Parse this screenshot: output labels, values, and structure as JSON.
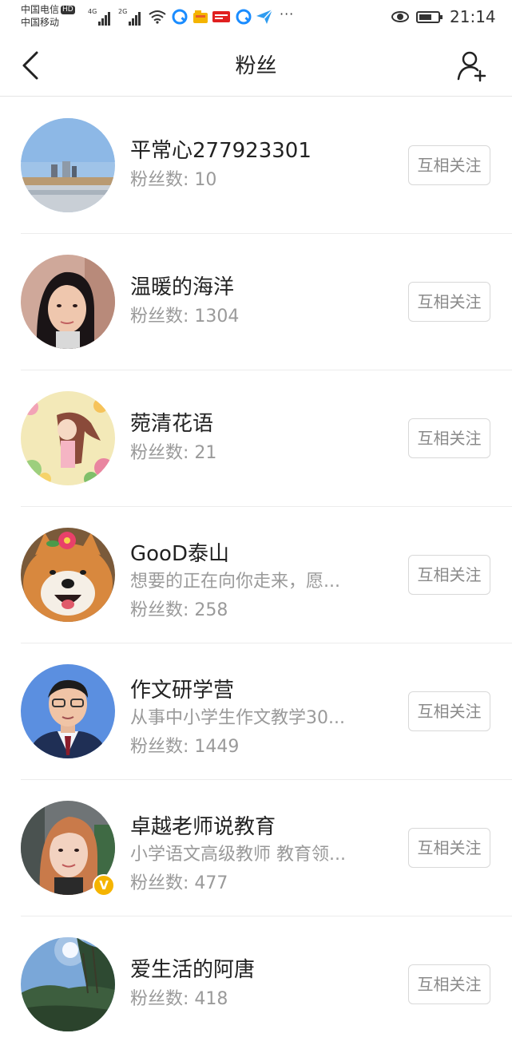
{
  "status_bar": {
    "carrier_1": "中国电信",
    "hd_badge": "HD",
    "carrier_2": "中国移动",
    "net_1": "4G",
    "net_2": "2G",
    "time": "21:14",
    "more": "···"
  },
  "nav": {
    "title": "粉丝",
    "back_icon": "back-chevron-icon",
    "add_icon": "add-user-icon"
  },
  "follow_label": "互相关注",
  "fans": [
    {
      "name": "平常心277923301",
      "desc": "",
      "fans": "粉丝数: 10",
      "avatar": "lakeside-landscape"
    },
    {
      "name": "温暖的海洋",
      "desc": "",
      "fans": "粉丝数: 1304",
      "avatar": "woman-portrait"
    },
    {
      "name": "菀清花语",
      "desc": "",
      "fans": "粉丝数: 21",
      "avatar": "floral-anime-girl"
    },
    {
      "name": "GooD泰山",
      "desc": "想要的正在向你走来，愿...",
      "fans": "粉丝数: 258",
      "avatar": "shiba-dog-with-flower"
    },
    {
      "name": "作文研学营",
      "desc": "从事中小学生作文教学30...",
      "fans": "粉丝数: 1449",
      "avatar": "man-in-suit"
    },
    {
      "name": "卓越老师说教育",
      "desc": "小学语文高级教师 教育领...",
      "fans": "粉丝数: 477",
      "avatar": "woman-selfie",
      "verified": "V"
    },
    {
      "name": "爱生活的阿唐",
      "desc": "",
      "fans": "粉丝数: 418",
      "avatar": "sky-and-trees"
    }
  ]
}
